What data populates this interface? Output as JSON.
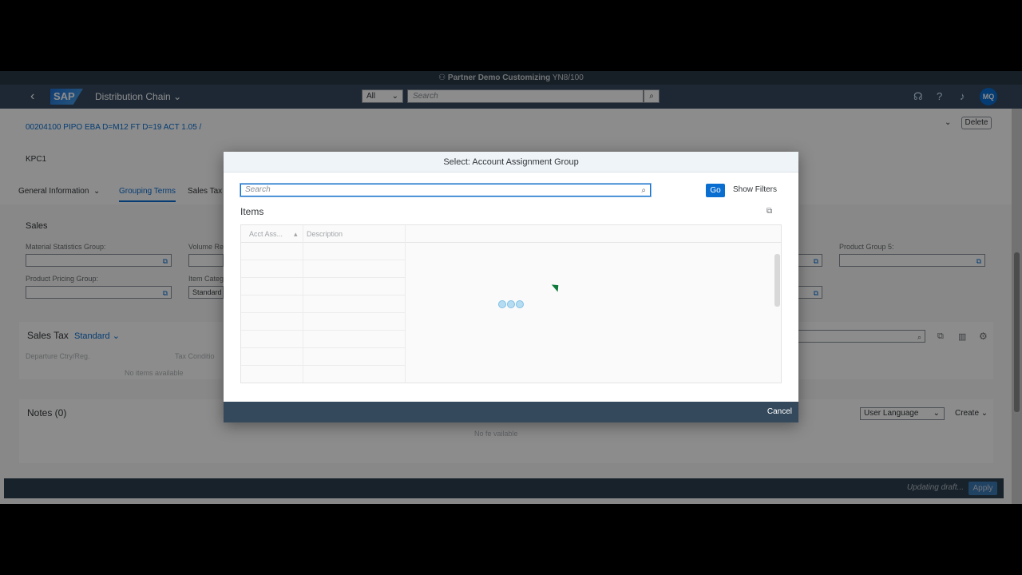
{
  "system_bar": {
    "title": "Partner Demo Customizing",
    "system": "YN8/100"
  },
  "shell": {
    "app_title": "Distribution Chain",
    "scope": "All",
    "search_placeholder": "Search",
    "avatar_initials": "MQ"
  },
  "header": {
    "title": "00204100 PIPO EBA D=M12 FT D=19 ACT 1.05 /",
    "subtitle": "KPC1",
    "delete_label": "Delete"
  },
  "tabs": [
    {
      "label": "General Information"
    },
    {
      "label": "Grouping Terms"
    },
    {
      "label": "Sales Tax"
    }
  ],
  "sales": {
    "title": "Sales",
    "fields": {
      "material_statistics_group": "Material Statistics Group:",
      "volume_rebate": "Volume Re",
      "product_group_5": "Product Group 5:",
      "product_pricing_group": "Product Pricing Group:",
      "item_category": "Item Categ",
      "item_category_value": "Standard"
    }
  },
  "sales_tax": {
    "title": "Sales Tax",
    "variant": "Standard",
    "col_departure": "Departure Ctry/Reg.",
    "col_tax_condition": "Tax Conditio",
    "empty": "No items available"
  },
  "notes": {
    "title": "Notes (0)",
    "language": "User Language",
    "create": "Create",
    "empty": "No fe        vailable"
  },
  "footer": {
    "status": "Updating draft...",
    "apply": "Apply"
  },
  "dialog": {
    "title": "Select: Account Assignment Group",
    "search_placeholder": "Search",
    "go": "Go",
    "show_filters": "Show Filters",
    "items_title": "Items",
    "columns": [
      "Acct Ass...",
      "Description"
    ],
    "cancel": "Cancel"
  }
}
